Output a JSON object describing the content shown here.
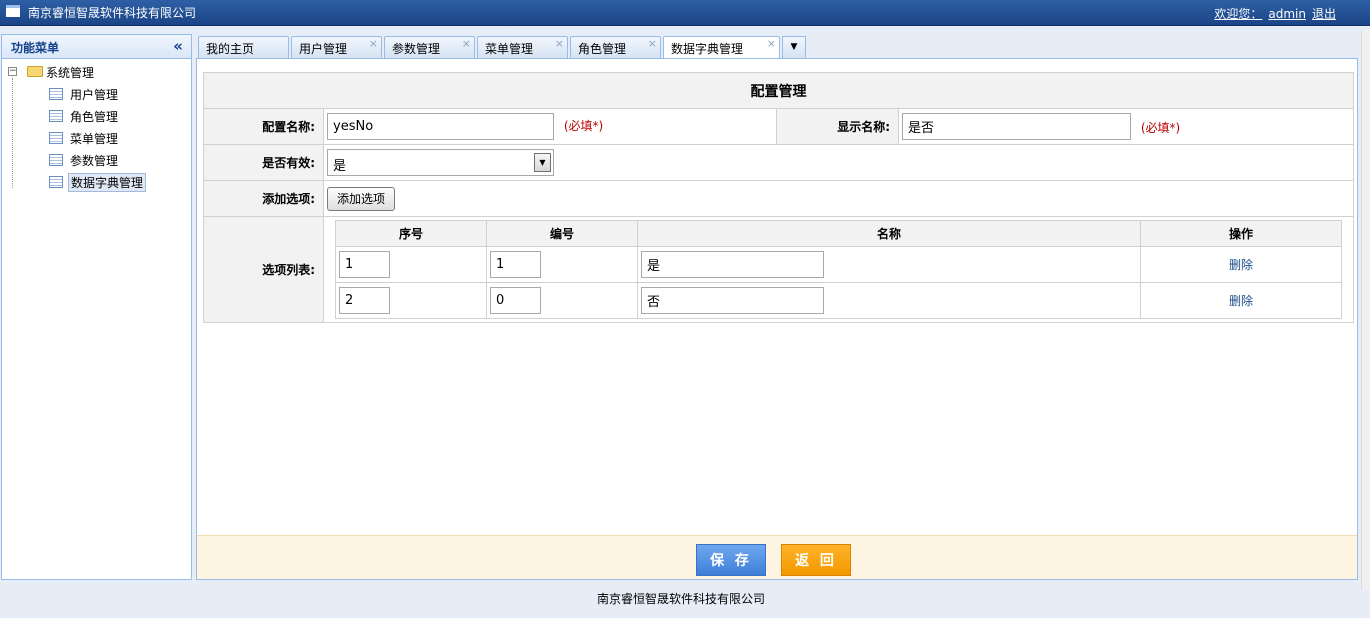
{
  "header": {
    "app_title": "南京睿恒智晟软件科技有限公司",
    "welcome": "欢迎您：",
    "username": "admin",
    "logout": "退出"
  },
  "sidebar": {
    "title": "功能菜单",
    "collapse_glyph": "«",
    "root_toggle": "−",
    "root_label": "系统管理",
    "items": [
      {
        "label": "用户管理"
      },
      {
        "label": "角色管理"
      },
      {
        "label": "菜单管理"
      },
      {
        "label": "参数管理"
      },
      {
        "label": "数据字典管理",
        "selected": true
      }
    ]
  },
  "tabs": {
    "close_glyph": "×",
    "menu_glyph": "▼",
    "items": [
      {
        "label": "我的主页",
        "closable": false
      },
      {
        "label": "用户管理",
        "closable": true
      },
      {
        "label": "参数管理",
        "closable": true
      },
      {
        "label": "菜单管理",
        "closable": true
      },
      {
        "label": "角色管理",
        "closable": true
      },
      {
        "label": "数据字典管理",
        "closable": true,
        "active": true
      }
    ]
  },
  "form": {
    "title": "配置管理",
    "config_name_label": "配置名称:",
    "config_name_value": "yesNo",
    "display_name_label": "显示名称:",
    "display_name_value": "是否",
    "required_mark": "(必填*)",
    "valid_label": "是否有效:",
    "valid_value": "是",
    "add_option_label": "添加选项:",
    "add_option_button": "添加选项",
    "options_label": "选项列表:",
    "options": {
      "headers": [
        "序号",
        "编号",
        "名称",
        "操作"
      ],
      "rows": [
        {
          "seq": "1",
          "code": "1",
          "name": "是",
          "action": "删除"
        },
        {
          "seq": "2",
          "code": "0",
          "name": "否",
          "action": "删除"
        }
      ]
    }
  },
  "actions": {
    "save": "保 存",
    "back": "返 回"
  },
  "footer": {
    "text": "南京睿恒智晟软件科技有限公司"
  }
}
